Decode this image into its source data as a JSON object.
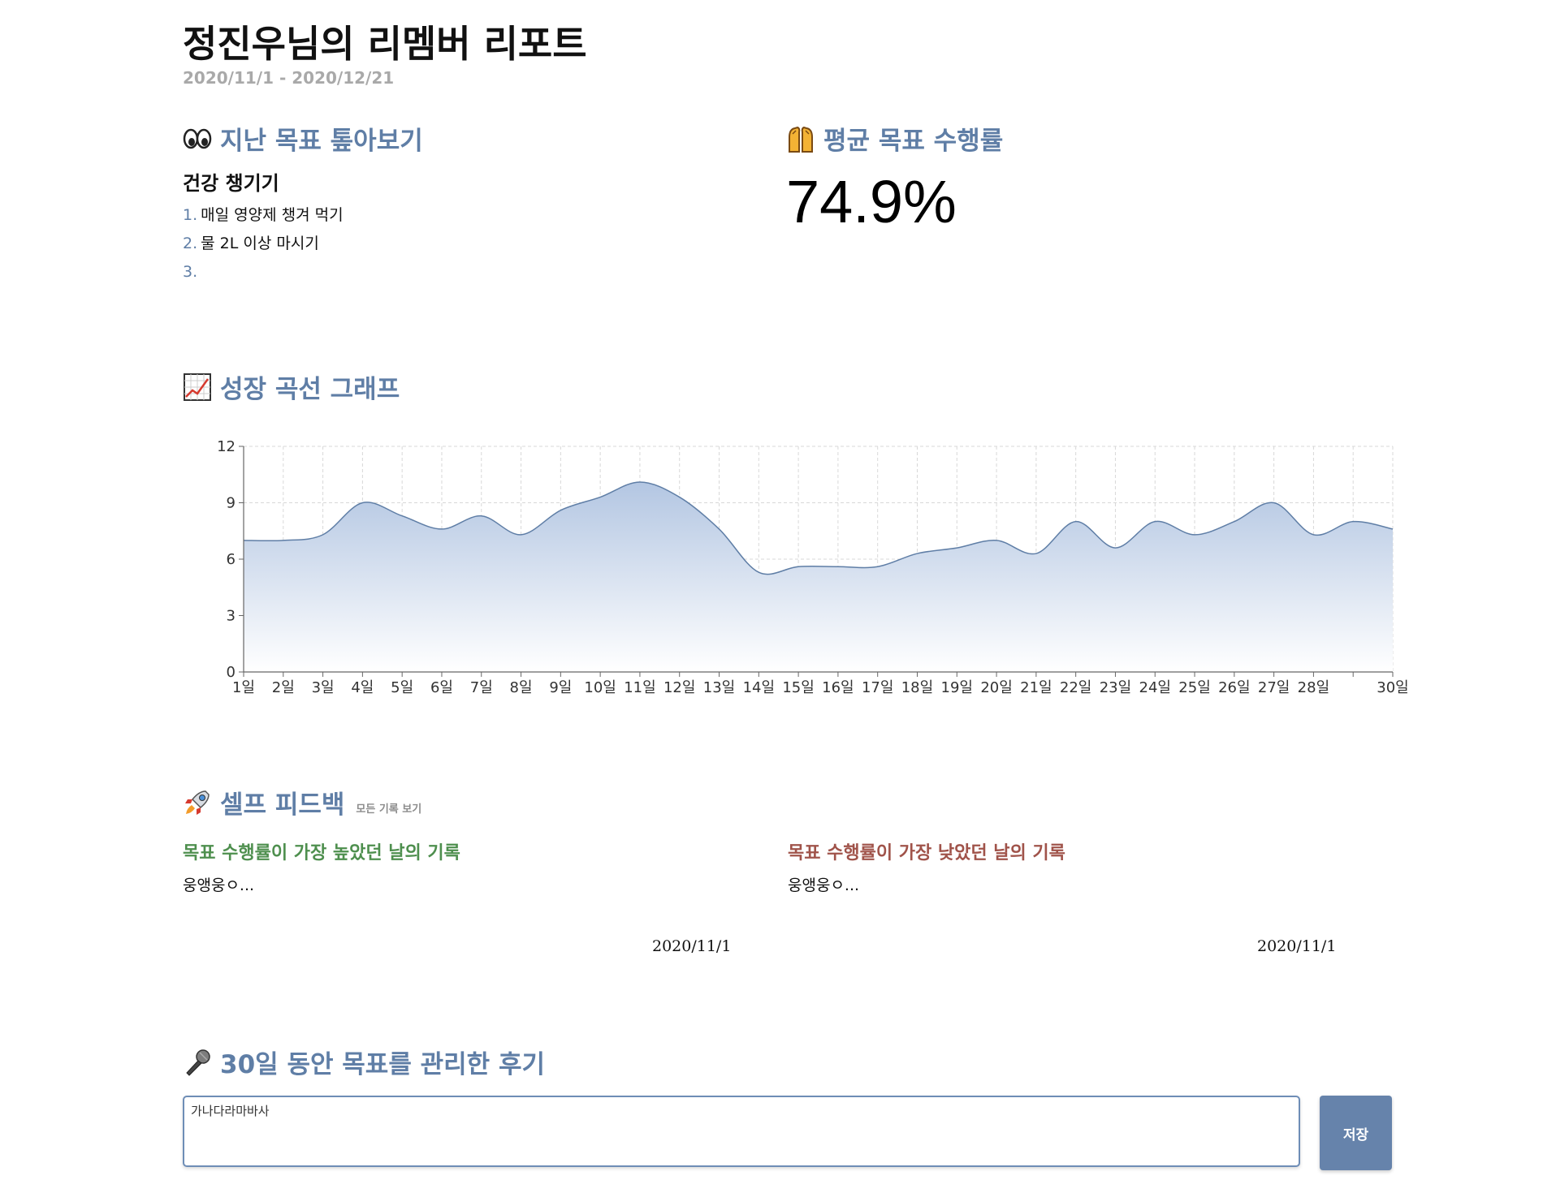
{
  "report": {
    "title": "정진우님의 리멤버 리포트",
    "date_range": "2020/11/1 - 2020/12/21"
  },
  "past_goals": {
    "heading": "지난 목표 톺아보기",
    "icon": "eyes-icon",
    "goal_title": "건강 챙기기",
    "items": [
      {
        "num": "1.",
        "text": "매일 영양제 챙겨 먹기"
      },
      {
        "num": "2.",
        "text": "물 2L 이상 마시기"
      },
      {
        "num": "3.",
        "text": ""
      }
    ]
  },
  "average": {
    "heading": "평균 목표 수행률",
    "icon": "raised-hands-icon",
    "value": "74.9%"
  },
  "growth": {
    "heading": "성장 곡선 그래프",
    "icon": "chart-increasing-icon"
  },
  "chart_data": {
    "type": "area",
    "title": "",
    "xlabel": "",
    "ylabel": "",
    "x": [
      1,
      2,
      3,
      4,
      5,
      6,
      7,
      8,
      9,
      10,
      11,
      12,
      13,
      14,
      15,
      16,
      17,
      18,
      19,
      20,
      21,
      22,
      23,
      24,
      25,
      26,
      27,
      28,
      29,
      30
    ],
    "tick_labels": [
      "1일",
      "2일",
      "3일",
      "4일",
      "5일",
      "6일",
      "7일",
      "8일",
      "9일",
      "10일",
      "11일",
      "12일",
      "13일",
      "14일",
      "15일",
      "16일",
      "17일",
      "18일",
      "19일",
      "20일",
      "21일",
      "22일",
      "23일",
      "24일",
      "25일",
      "26일",
      "27일",
      "28일",
      "",
      "30일"
    ],
    "series": [
      {
        "values": [
          7,
          7,
          7.3,
          9,
          8.3,
          7.6,
          8.3,
          7.3,
          8.6,
          9.3,
          10.1,
          9.3,
          7.6,
          5.3,
          5.6,
          5.6,
          5.6,
          6.3,
          6.6,
          7,
          6.3,
          8,
          6.6,
          8,
          7.3,
          8,
          9,
          7.3,
          8,
          7.6
        ]
      }
    ],
    "ylim": [
      0,
      12
    ],
    "yticks": [
      0,
      3,
      6,
      9,
      12
    ],
    "grid": true,
    "colors": {
      "line": "#5f7ea6",
      "fill_top": "#b3c6e2",
      "fill_bottom": "#ffffff",
      "grid": "#d8d8d8",
      "axis": "#666666"
    }
  },
  "self_feedback": {
    "heading": "셀프 피드백",
    "icon": "rocket-icon",
    "view_all_label": "모든 기록 보기",
    "high": {
      "label": "목표 수행률이 가장 높았던 날의 기록",
      "text": "웅앵웅ㅇ...",
      "date": "2020/11/1"
    },
    "low": {
      "label": "목표 수행률이 가장 낮았던 날의 기록",
      "text": "웅앵웅ㅇ...",
      "date": "2020/11/1"
    }
  },
  "review": {
    "heading": "30일 동안 목표를 관리한 후기",
    "icon": "microphone-icon",
    "input_value": "가나다라마바사",
    "save_label": "저장"
  },
  "colors": {
    "accent": "#5f7ea6",
    "high": "#4e8f4e",
    "low": "#a0534a",
    "button": "#6683ab"
  }
}
